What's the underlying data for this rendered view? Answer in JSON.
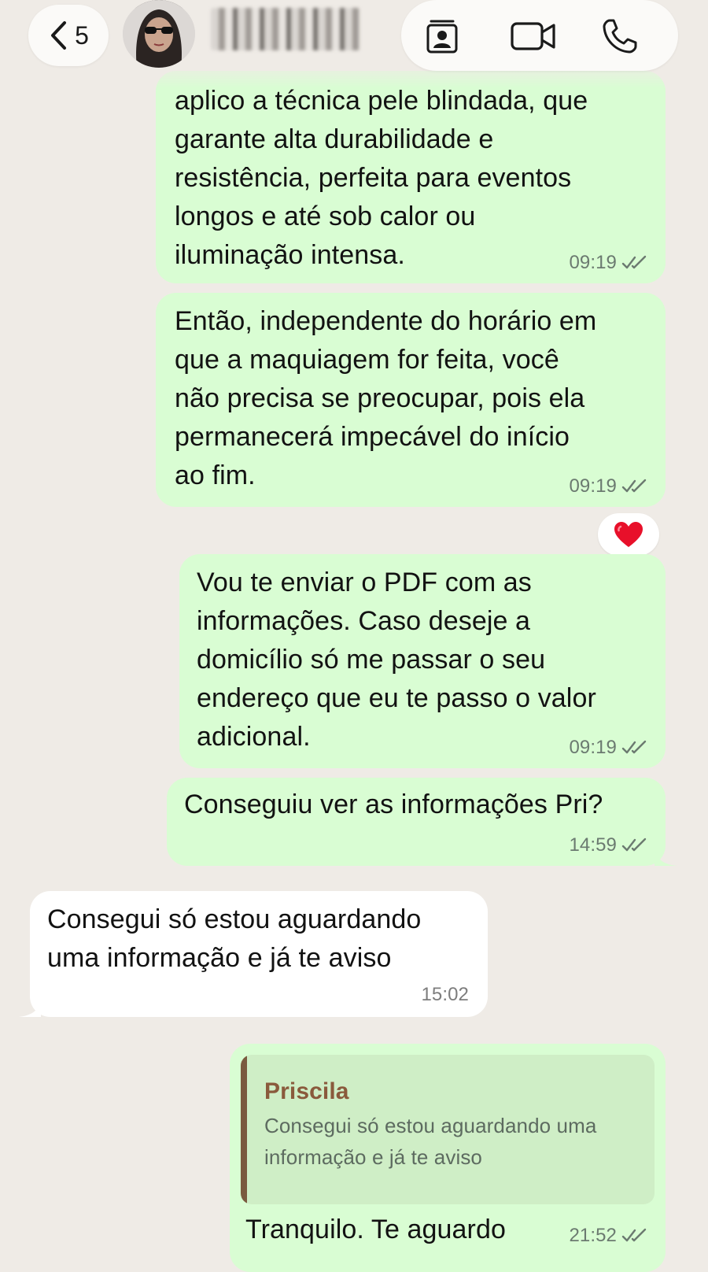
{
  "header": {
    "back_count": "5",
    "contact_name": ""
  },
  "messages": [
    {
      "id": "m1",
      "direction": "outgoing",
      "text": "aplico a técnica pele blindada, que\ngarante alta durabilidade e\nresistência, perfeita para eventos\nlongos e até sob calor ou\niluminação intensa.",
      "time": "09:19",
      "status": "read"
    },
    {
      "id": "m2",
      "direction": "outgoing",
      "text": "Então, independente do horário em\nque a maquiagem for feita, você\nnão precisa se preocupar, pois ela\npermanecerá impecável do início\nao fim.",
      "time": "09:19",
      "status": "read",
      "reaction": "❤️"
    },
    {
      "id": "m3",
      "direction": "outgoing",
      "text": "Vou te enviar o PDF com as\ninformações. Caso deseje a\ndomicílio só me passar o seu\nendereço que eu te passo o valor\nadicional.",
      "time": "09:19",
      "status": "read"
    },
    {
      "id": "m4",
      "direction": "outgoing",
      "text": "Conseguiu ver as informações Pri?",
      "time": "14:59",
      "status": "read"
    },
    {
      "id": "m5",
      "direction": "incoming",
      "text": "Consegui só estou aguardando\numa informação e já te aviso",
      "time": "15:02"
    },
    {
      "id": "m6",
      "direction": "outgoing",
      "quote": {
        "author": "Priscila",
        "text": "Consegui só estou aguardando uma\ninformação e já te aviso"
      },
      "text": "Tranquilo. Te aguardo",
      "time": "21:52",
      "status": "read"
    }
  ],
  "colors": {
    "background": "#efebe6",
    "outgoing_bubble": "#d9fdd3",
    "incoming_bubble": "#ffffff",
    "quote_author": "#8a5a3c",
    "quote_bar": "#7a5a3f"
  },
  "icons": [
    "chevron-left-icon",
    "contact-card-icon",
    "video-camera-icon",
    "phone-icon",
    "double-check-icon"
  ]
}
